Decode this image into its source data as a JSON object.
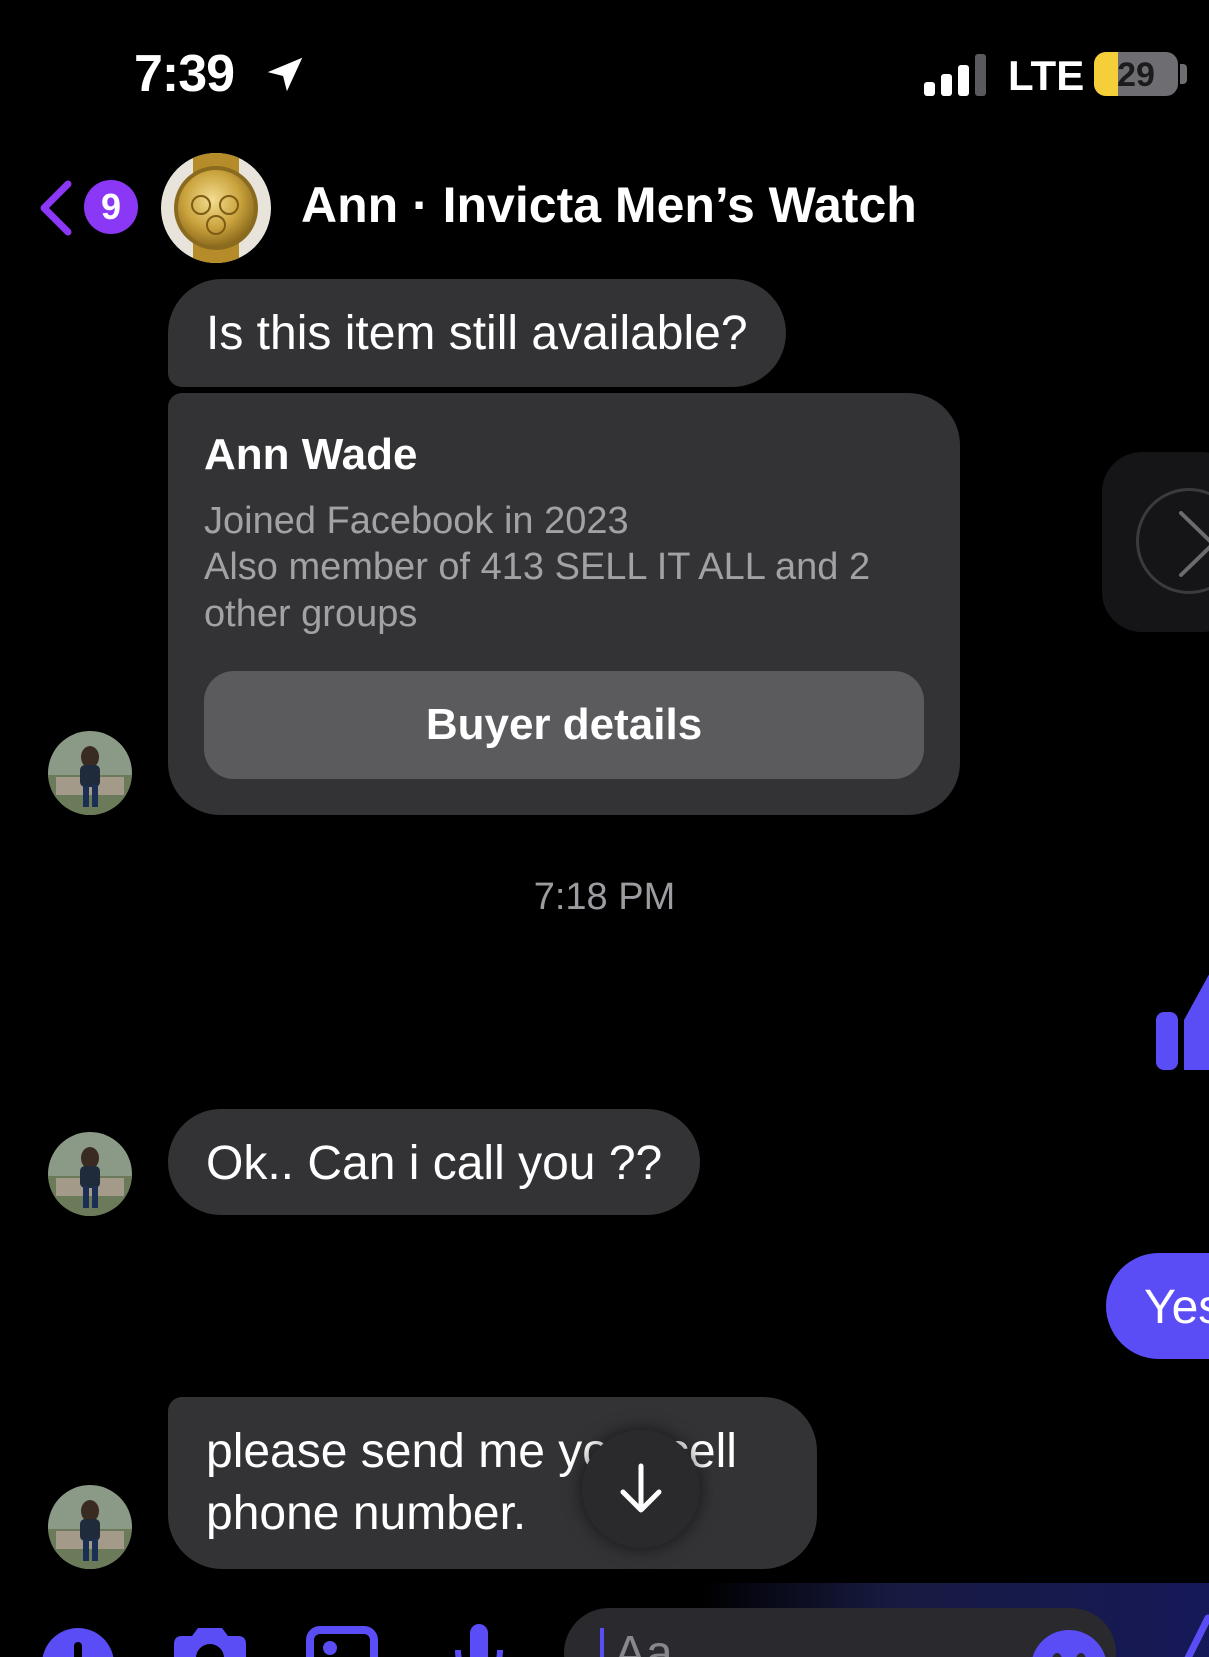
{
  "status_bar": {
    "time": "7:39",
    "network": "LTE",
    "battery": "29",
    "battery_level": 0.29
  },
  "header": {
    "back_badge": "9",
    "title": "Ann · Invicta Men’s Watch"
  },
  "messages": {
    "first": "Is this item still available?",
    "buyer_card": {
      "name": "Ann Wade",
      "joined": "Joined Facebook in 2023",
      "groups": "Also member of 413 SELL IT ALL and 2 other groups",
      "button": "Buyer details"
    },
    "timestamp": "7:18 PM",
    "call": "Ok.. Can i call you ??",
    "reply": "Yes",
    "cell_request": "please send me your cell phone number."
  },
  "composer": {
    "placeholder": "Aa"
  },
  "colors": {
    "accent": "#5a4df5",
    "badge": "#8a38f5",
    "bubble": "#333336"
  }
}
